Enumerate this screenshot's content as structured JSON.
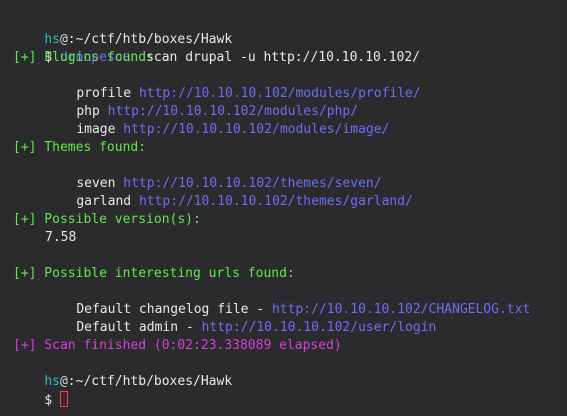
{
  "prompt": {
    "user": "hs",
    "at": "@",
    "colon_path": ":~/ctf/htb/boxes/Hawk",
    "dollar": "$"
  },
  "command": {
    "program": "droopescan",
    "args": " scan drupal -u http://10.10.10.102/"
  },
  "plugins": {
    "header": "[+] Plugins found:",
    "items": [
      {
        "name": "profile",
        "url": "http://10.10.10.102/modules/profile/"
      },
      {
        "name": "php",
        "url": "http://10.10.10.102/modules/php/"
      },
      {
        "name": "image",
        "url": "http://10.10.10.102/modules/image/"
      }
    ]
  },
  "themes": {
    "header": "[+] Themes found:",
    "items": [
      {
        "name": "seven",
        "url": "http://10.10.10.102/themes/seven/"
      },
      {
        "name": "garland",
        "url": "http://10.10.10.102/themes/garland/"
      }
    ]
  },
  "versions": {
    "header": "[+] Possible version(s):",
    "items": [
      "7.58"
    ]
  },
  "interesting_urls": {
    "header": "[+] Possible interesting urls found:",
    "items": [
      {
        "label": "Default changelog file - ",
        "url": "http://10.10.10.102/CHANGELOG.txt"
      },
      {
        "label": "Default admin - ",
        "url": "http://10.10.10.102/user/login"
      }
    ]
  },
  "scan_finished": "[+] Scan finished (0:02:23.338089 elapsed)",
  "colors": {
    "background": "#2b2b2d",
    "url_blue": "#6c6df5",
    "status_green": "#61e74d",
    "prompt_cyan": "#27c3b8",
    "finished_purple": "#d43fdd",
    "cursor_red": "#ff3b3b"
  },
  "icons": {
    "cursor": "text-cursor-icon"
  }
}
